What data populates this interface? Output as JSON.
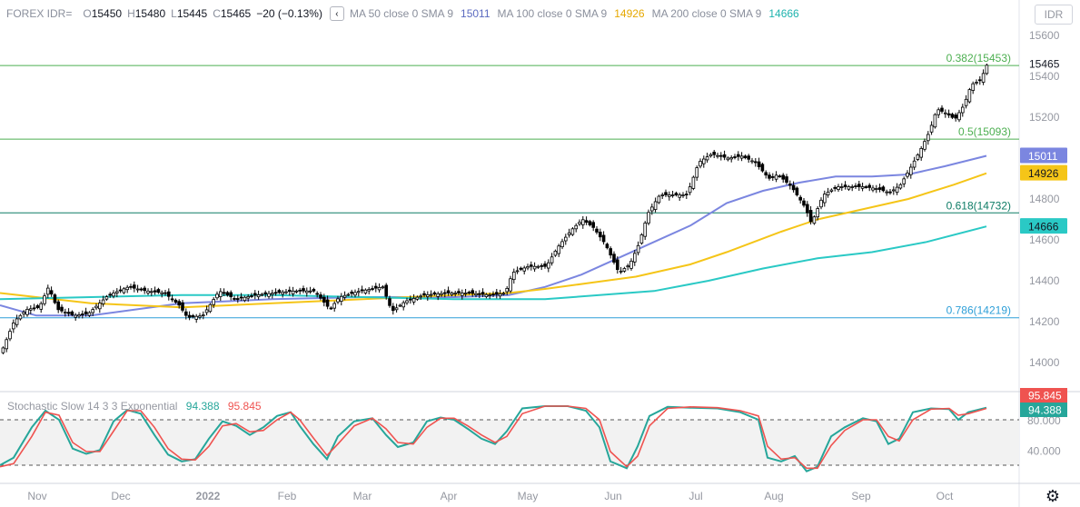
{
  "header": {
    "symbol": "FOREX IDR=",
    "o_label": "O",
    "o_value": "15450",
    "h_label": "H",
    "h_value": "15480",
    "l_label": "L",
    "l_value": "15445",
    "c_label": "C",
    "c_value": "15465",
    "change": "−20 (−0.13%)",
    "collapse_label": "‹",
    "ma50_label": "MA 50 close 0 SMA 9",
    "ma50_value": "15011",
    "ma100_label": "MA 100 close 0 SMA 9",
    "ma100_value": "14926",
    "ma200_label": "MA 200 close 0 SMA 9",
    "ma200_value": "14666"
  },
  "currency_button": "IDR",
  "stoch_header": {
    "label": "Stochastic Slow 14 3 3 Exponential",
    "k_value": "94.388",
    "d_value": "95.845"
  },
  "settings_icon": "gear-icon",
  "colors": {
    "ma50": "#7b86e0",
    "ma100": "#f5c518",
    "ma200": "#2ac9c5",
    "fib_green": "#4caf50",
    "fib_teal": "#0e7c66",
    "fib_blue": "#2e9fd8",
    "k": "#26a69a",
    "d": "#ef5350"
  },
  "chart_data": [
    {
      "type": "candlestick",
      "title": "FOREX IDR=",
      "y_ticks": [
        "15600",
        "15400",
        "15200",
        "15000",
        "14800",
        "14600",
        "14400",
        "14200",
        "14000"
      ],
      "ylim": [
        13990,
        15630
      ],
      "x_ticks": [
        "Nov",
        "Dec",
        "2022",
        "Feb",
        "Mar",
        "Apr",
        "May",
        "Jun",
        "Jul",
        "Aug",
        "Sep",
        "Oct"
      ],
      "last_price": "15465",
      "fib_levels": [
        {
          "label": "0.382(15453)",
          "value": 15453
        },
        {
          "label": "0.5(15093)",
          "value": 15093
        },
        {
          "label": "0.618(14732)",
          "value": 14732
        },
        {
          "label": "0.786(14219)",
          "value": 14219
        }
      ],
      "ma_badges": [
        "15011",
        "14926",
        "14666"
      ],
      "close_path": [
        [
          0,
          14050
        ],
        [
          14,
          14200
        ],
        [
          28,
          14260
        ],
        [
          42,
          14270
        ],
        [
          52,
          14370
        ],
        [
          62,
          14260
        ],
        [
          80,
          14230
        ],
        [
          96,
          14240
        ],
        [
          118,
          14330
        ],
        [
          140,
          14370
        ],
        [
          160,
          14350
        ],
        [
          180,
          14340
        ],
        [
          196,
          14280
        ],
        [
          205,
          14220
        ],
        [
          222,
          14230
        ],
        [
          240,
          14350
        ],
        [
          258,
          14310
        ],
        [
          280,
          14330
        ],
        [
          300,
          14340
        ],
        [
          322,
          14350
        ],
        [
          345,
          14350
        ],
        [
          362,
          14260
        ],
        [
          372,
          14320
        ],
        [
          395,
          14350
        ],
        [
          420,
          14370
        ],
        [
          430,
          14250
        ],
        [
          445,
          14300
        ],
        [
          465,
          14330
        ],
        [
          490,
          14340
        ],
        [
          515,
          14340
        ],
        [
          540,
          14330
        ],
        [
          555,
          14340
        ],
        [
          563,
          14440
        ],
        [
          580,
          14470
        ],
        [
          600,
          14470
        ],
        [
          612,
          14560
        ],
        [
          628,
          14650
        ],
        [
          640,
          14700
        ],
        [
          652,
          14660
        ],
        [
          665,
          14580
        ],
        [
          680,
          14440
        ],
        [
          692,
          14480
        ],
        [
          702,
          14580
        ],
        [
          712,
          14730
        ],
        [
          725,
          14820
        ],
        [
          740,
          14820
        ],
        [
          755,
          14820
        ],
        [
          768,
          14980
        ],
        [
          782,
          15020
        ],
        [
          800,
          15000
        ],
        [
          815,
          15010
        ],
        [
          830,
          14980
        ],
        [
          845,
          14900
        ],
        [
          855,
          14920
        ],
        [
          870,
          14860
        ],
        [
          885,
          14760
        ],
        [
          892,
          14680
        ],
        [
          905,
          14820
        ],
        [
          920,
          14860
        ],
        [
          935,
          14860
        ],
        [
          950,
          14860
        ],
        [
          965,
          14850
        ],
        [
          978,
          14830
        ],
        [
          990,
          14870
        ],
        [
          1002,
          14960
        ],
        [
          1012,
          15040
        ],
        [
          1022,
          15130
        ],
        [
          1030,
          15240
        ],
        [
          1040,
          15220
        ],
        [
          1050,
          15190
        ],
        [
          1060,
          15260
        ],
        [
          1068,
          15360
        ],
        [
          1078,
          15380
        ],
        [
          1086,
          15465
        ]
      ],
      "ma_series": [
        {
          "name": "MA 50 close 0 SMA 9",
          "values": [
            [
              0,
              14280
            ],
            [
              40,
              14230
            ],
            [
              100,
              14230
            ],
            [
              200,
              14290
            ],
            [
              300,
              14310
            ],
            [
              400,
              14320
            ],
            [
              500,
              14320
            ],
            [
              560,
              14330
            ],
            [
              600,
              14370
            ],
            [
              640,
              14430
            ],
            [
              700,
              14550
            ],
            [
              760,
              14670
            ],
            [
              800,
              14780
            ],
            [
              840,
              14840
            ],
            [
              880,
              14880
            ],
            [
              920,
              14910
            ],
            [
              960,
              14910
            ],
            [
              1000,
              14920
            ],
            [
              1040,
              14960
            ],
            [
              1086,
              15011
            ]
          ]
        },
        {
          "name": "MA 100 close 0 SMA 9",
          "values": [
            [
              0,
              14340
            ],
            [
              100,
              14290
            ],
            [
              200,
              14270
            ],
            [
              300,
              14290
            ],
            [
              400,
              14310
            ],
            [
              500,
              14330
            ],
            [
              560,
              14340
            ],
            [
              600,
              14360
            ],
            [
              650,
              14390
            ],
            [
              700,
              14420
            ],
            [
              760,
              14480
            ],
            [
              800,
              14540
            ],
            [
              860,
              14640
            ],
            [
              900,
              14700
            ],
            [
              960,
              14760
            ],
            [
              1000,
              14800
            ],
            [
              1050,
              14870
            ],
            [
              1086,
              14926
            ]
          ]
        },
        {
          "name": "MA 200 close 0 SMA 9",
          "values": [
            [
              0,
              14310
            ],
            [
              100,
              14320
            ],
            [
              200,
              14330
            ],
            [
              300,
              14330
            ],
            [
              400,
              14320
            ],
            [
              500,
              14310
            ],
            [
              600,
              14310
            ],
            [
              660,
              14330
            ],
            [
              720,
              14350
            ],
            [
              780,
              14400
            ],
            [
              840,
              14460
            ],
            [
              900,
              14510
            ],
            [
              960,
              14540
            ],
            [
              1020,
              14590
            ],
            [
              1086,
              14666
            ]
          ]
        }
      ]
    },
    {
      "type": "line",
      "title": "Stochastic Slow 14 3 3 Exponential",
      "y_ticks": [
        "80.000",
        "40.000"
      ],
      "ylim": [
        10,
        100
      ],
      "reference_lines": [
        80,
        20
      ],
      "series": [
        {
          "name": "%K",
          "values": [
            [
              0,
              20
            ],
            [
              15,
              30
            ],
            [
              35,
              70
            ],
            [
              50,
              92
            ],
            [
              65,
              80
            ],
            [
              80,
              42
            ],
            [
              95,
              35
            ],
            [
              110,
              40
            ],
            [
              125,
              78
            ],
            [
              140,
              93
            ],
            [
              155,
              88
            ],
            [
              170,
              60
            ],
            [
              185,
              34
            ],
            [
              200,
              25
            ],
            [
              215,
              28
            ],
            [
              230,
              55
            ],
            [
              245,
              78
            ],
            [
              260,
              72
            ],
            [
              275,
              60
            ],
            [
              290,
              70
            ],
            [
              305,
              85
            ],
            [
              320,
              90
            ],
            [
              330,
              72
            ],
            [
              345,
              48
            ],
            [
              360,
              28
            ],
            [
              372,
              58
            ],
            [
              390,
              78
            ],
            [
              410,
              82
            ],
            [
              425,
              60
            ],
            [
              438,
              44
            ],
            [
              455,
              50
            ],
            [
              470,
              78
            ],
            [
              485,
              83
            ],
            [
              500,
              80
            ],
            [
              515,
              68
            ],
            [
              530,
              55
            ],
            [
              545,
              48
            ],
            [
              558,
              65
            ],
            [
              575,
              95
            ],
            [
              600,
              98
            ],
            [
              625,
              98
            ],
            [
              645,
              92
            ],
            [
              660,
              70
            ],
            [
              672,
              25
            ],
            [
              690,
              16
            ],
            [
              702,
              45
            ],
            [
              715,
              85
            ],
            [
              735,
              97
            ],
            [
              760,
              96
            ],
            [
              790,
              95
            ],
            [
              815,
              90
            ],
            [
              835,
              80
            ],
            [
              845,
              30
            ],
            [
              860,
              25
            ],
            [
              875,
              32
            ],
            [
              888,
              12
            ],
            [
              900,
              18
            ],
            [
              915,
              58
            ],
            [
              930,
              70
            ],
            [
              950,
              82
            ],
            [
              965,
              78
            ],
            [
              978,
              48
            ],
            [
              990,
              55
            ],
            [
              1005,
              90
            ],
            [
              1025,
              95
            ],
            [
              1045,
              94
            ],
            [
              1055,
              80
            ],
            [
              1066,
              90
            ],
            [
              1086,
              96
            ]
          ]
        },
        {
          "name": "%D",
          "values": [
            [
              0,
              18
            ],
            [
              15,
              22
            ],
            [
              35,
              58
            ],
            [
              50,
              90
            ],
            [
              65,
              86
            ],
            [
              80,
              50
            ],
            [
              95,
              38
            ],
            [
              110,
              38
            ],
            [
              125,
              65
            ],
            [
              140,
              92
            ],
            [
              155,
              92
            ],
            [
              170,
              70
            ],
            [
              185,
              42
            ],
            [
              200,
              28
            ],
            [
              215,
              27
            ],
            [
              230,
              45
            ],
            [
              245,
              72
            ],
            [
              260,
              75
            ],
            [
              275,
              64
            ],
            [
              290,
              66
            ],
            [
              305,
              80
            ],
            [
              320,
              90
            ],
            [
              330,
              80
            ],
            [
              345,
              56
            ],
            [
              360,
              33
            ],
            [
              372,
              48
            ],
            [
              390,
              72
            ],
            [
              410,
              82
            ],
            [
              425,
              68
            ],
            [
              438,
              50
            ],
            [
              455,
              48
            ],
            [
              470,
              70
            ],
            [
              485,
              82
            ],
            [
              500,
              82
            ],
            [
              515,
              72
            ],
            [
              530,
              60
            ],
            [
              545,
              50
            ],
            [
              558,
              58
            ],
            [
              575,
              88
            ],
            [
              600,
              98
            ],
            [
              625,
              98
            ],
            [
              645,
              95
            ],
            [
              660,
              80
            ],
            [
              672,
              38
            ],
            [
              690,
              18
            ],
            [
              702,
              32
            ],
            [
              715,
              72
            ],
            [
              735,
              95
            ],
            [
              760,
              97
            ],
            [
              790,
              96
            ],
            [
              815,
              92
            ],
            [
              835,
              85
            ],
            [
              845,
              45
            ],
            [
              860,
              28
            ],
            [
              875,
              30
            ],
            [
              888,
              16
            ],
            [
              900,
              16
            ],
            [
              915,
              46
            ],
            [
              930,
              66
            ],
            [
              950,
              80
            ],
            [
              965,
              80
            ],
            [
              978,
              58
            ],
            [
              990,
              52
            ],
            [
              1005,
              80
            ],
            [
              1025,
              94
            ],
            [
              1045,
              95
            ],
            [
              1055,
              86
            ],
            [
              1066,
              88
            ],
            [
              1086,
              95
            ]
          ]
        }
      ],
      "last_values": [
        "95.845",
        "94.388"
      ]
    }
  ]
}
